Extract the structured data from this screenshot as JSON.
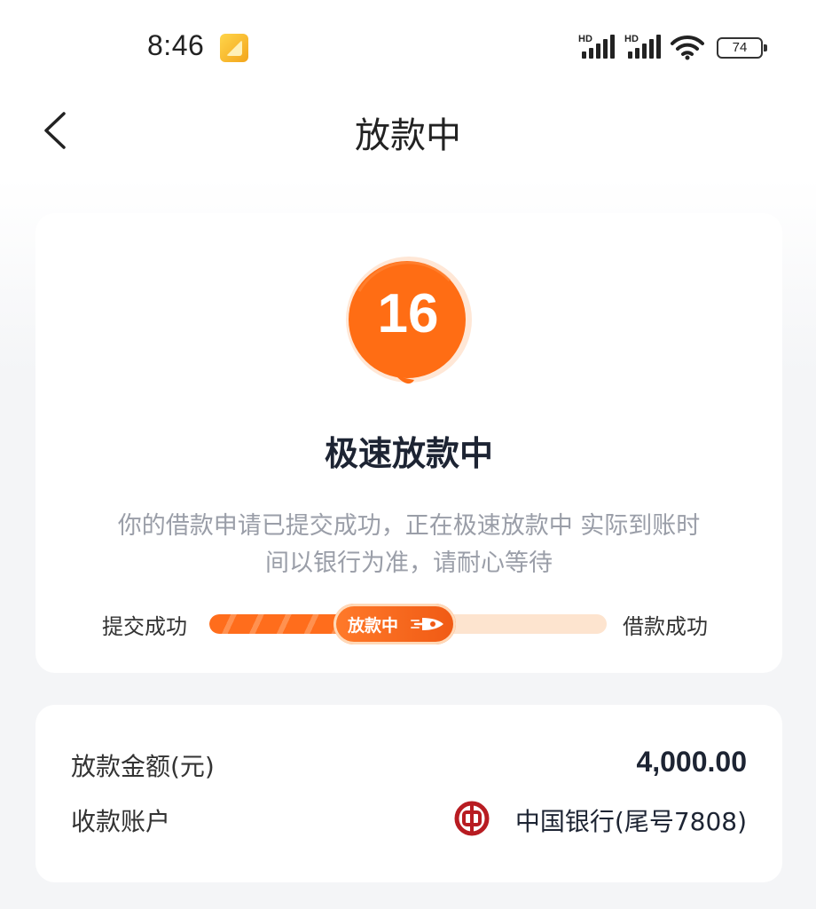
{
  "status_bar": {
    "time": "8:46",
    "signal1_label": "HD",
    "signal2_label": "HD",
    "battery": "74"
  },
  "header": {
    "title": "放款中"
  },
  "status_card": {
    "countdown": "16",
    "headline": "极速放款中",
    "description_line1": "你的借款申请已提交成功，正在极速放款中 实际到账时",
    "description_line2": "间以银行为准，请耐心等待",
    "progress": {
      "start_label": "提交成功",
      "current_label": "放款中",
      "end_label": "借款成功",
      "fraction": 0.62
    }
  },
  "details": {
    "amount_label": "放款金额(元)",
    "amount_value": "4,000.00",
    "account_label": "收款账户",
    "account_value": "中国银行(尾号7808)"
  },
  "colors": {
    "accent": "#ff6d1c",
    "track": "#fde4cf",
    "bank": "#b81c22"
  },
  "icons": [
    "notification-icon",
    "signal-icon",
    "wifi-icon",
    "battery-icon",
    "back-arrow-icon",
    "rocket-icon",
    "bank-of-china-icon"
  ]
}
